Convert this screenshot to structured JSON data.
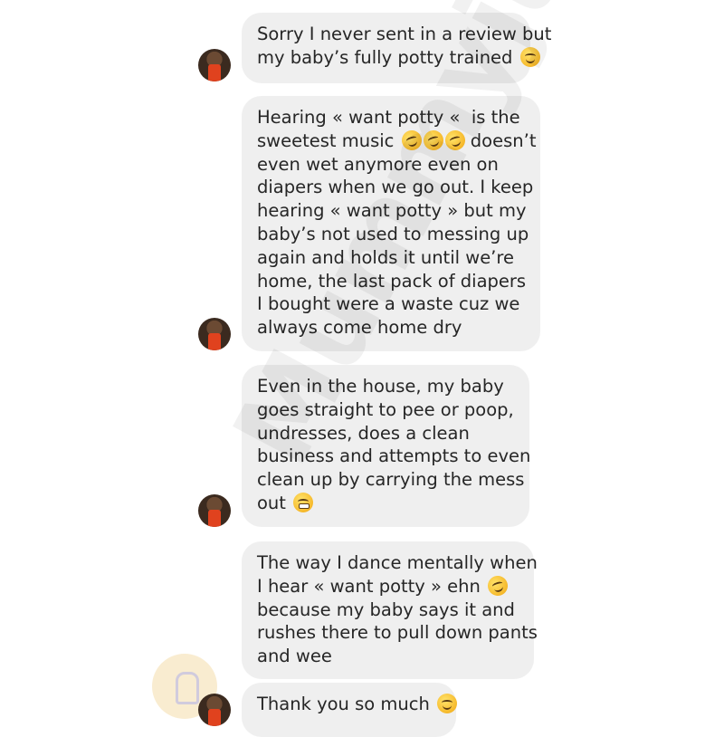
{
  "watermark": "Mummyjunicc",
  "messages": [
    {
      "lines": [
        "Sorry I never sent in a review but",
        "my baby’s fully potty trained"
      ],
      "emoji": "smiling-face-icon"
    },
    {
      "lines": [
        "Hearing « want potty «  is the",
        "sweetest music ",
        "even wet anymore even on",
        "diapers when we go out. I keep",
        "hearing « want potty » but my",
        "baby’s not used to messing up",
        "again and holds it until we’re",
        "home, the last pack of diapers",
        "I bought were a waste cuz we",
        "always come home dry"
      ],
      "line2_suffix": " doesn’t",
      "emoji": "rolling-on-floor-laughing-icon"
    },
    {
      "lines": [
        "Even in the house, my baby",
        "goes straight to pee or poop,",
        "undresses, does a clean",
        "business and attempts to even",
        "clean up by carrying the mess",
        "out "
      ],
      "emoji": "grimacing-face-icon"
    },
    {
      "lines": [
        "The way I dance mentally when",
        "I hear « want potty » ehn ",
        "because my baby says it and",
        "rushes there to pull down pants",
        "and wee"
      ],
      "emoji": "rolling-on-floor-laughing-icon"
    },
    {
      "lines": [
        "Thank you so much "
      ],
      "emoji": "smiling-face-icon"
    }
  ]
}
